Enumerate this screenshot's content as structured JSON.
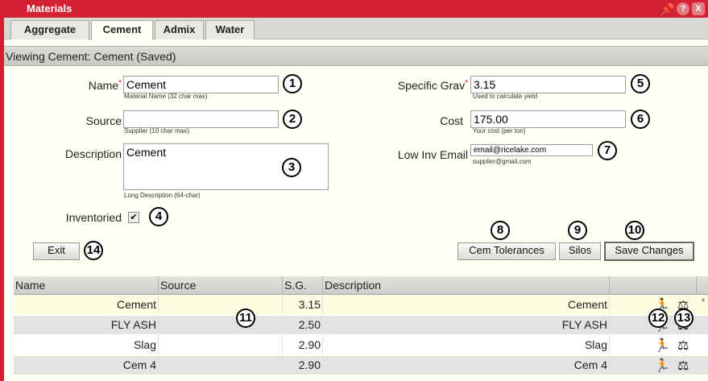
{
  "window": {
    "title": "Materials",
    "icons": {
      "pin": "pin-icon",
      "help": "?",
      "close": "X"
    }
  },
  "tabs": [
    {
      "label": "Aggregate",
      "active": false
    },
    {
      "label": "Cement",
      "active": true
    },
    {
      "label": "Admix",
      "active": false
    },
    {
      "label": "Water",
      "active": false
    }
  ],
  "view_header": "Viewing Cement: Cement (Saved)",
  "form": {
    "name": {
      "label": "Name",
      "value": "Cement",
      "hint": "Material Name (32 char max)"
    },
    "source": {
      "label": "Source",
      "value": "",
      "hint": "Supplier (10 char max)"
    },
    "description": {
      "label": "Description",
      "value": "Cement",
      "hint": "Long Description (64-char)"
    },
    "inventoried": {
      "label": "Inventoried",
      "checked": true,
      "mark": "✔"
    },
    "specific_grav": {
      "label": "Specific Grav",
      "value": "3.15",
      "hint": "Used to calculate yield"
    },
    "cost": {
      "label": "Cost",
      "value": "175.00",
      "hint": "Your cost (per ton)"
    },
    "low_inv_email": {
      "label": "Low Inv Email",
      "value": "email@ricelake.com",
      "hint": "supplier@gmail.com"
    },
    "required_mark": "*"
  },
  "buttons": {
    "exit": "Exit",
    "cem_tolerances": "Cem Tolerances",
    "silos": "Silos",
    "save_changes": "Save Changes"
  },
  "callouts": [
    "1",
    "2",
    "3",
    "4",
    "5",
    "6",
    "7",
    "8",
    "9",
    "10",
    "11",
    "12",
    "13",
    "14"
  ],
  "table": {
    "columns": [
      "Name",
      "Source",
      "S.G.",
      "Description"
    ],
    "rows": [
      {
        "name": "Cement",
        "source": "",
        "sg": "3.15",
        "description": "Cement"
      },
      {
        "name": "FLY ASH",
        "source": "",
        "sg": "2.50",
        "description": "FLY ASH"
      },
      {
        "name": "Slag",
        "source": "",
        "sg": "2.90",
        "description": "Slag"
      },
      {
        "name": "Cem 4",
        "source": "",
        "sg": "2.90",
        "description": "Cem 4"
      }
    ],
    "row_colors": [
      "#fffbe0",
      "#e3e3e3",
      "#ffffff",
      "#e3e3e3"
    ],
    "action_icons": {
      "run": "run-icon",
      "weigh": "weigh-icon",
      "run_glyph": "🏃",
      "weigh_glyph": "⚖"
    }
  },
  "colors": {
    "accent": "#d42033"
  }
}
